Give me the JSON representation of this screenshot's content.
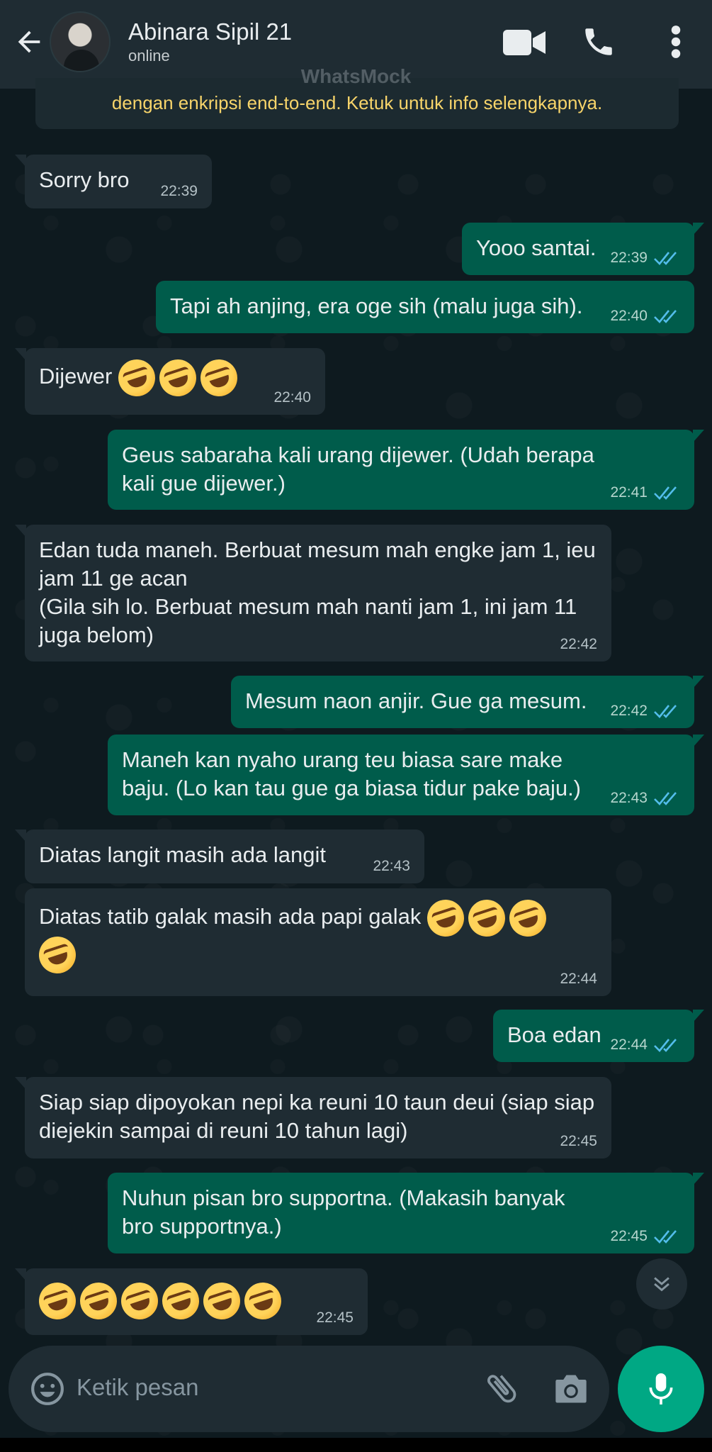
{
  "app": {
    "watermark": "WhatsMock"
  },
  "header": {
    "contact_name": "Abinara Sipil 21",
    "status": "online",
    "icons": [
      "back-arrow-icon",
      "video-call-icon",
      "phone-icon",
      "more-vert-icon"
    ]
  },
  "notice": {
    "text": "dengan enkripsi end-to-end. Ketuk untuk info selengkapnya."
  },
  "messages": [
    {
      "dir": "in",
      "text": "Sorry bro",
      "time": "22:39"
    },
    {
      "dir": "out",
      "text": "Yooo santai.",
      "time": "22:39",
      "read": true
    },
    {
      "dir": "out",
      "text": "Tapi ah anjing, era oge sih (malu juga sih).",
      "time": "22:40",
      "read": true
    },
    {
      "dir": "in",
      "text": "Dijewer",
      "emoji_count": 3,
      "time": "22:40"
    },
    {
      "dir": "out",
      "text": "Geus sabaraha kali urang dijewer. (Udah berapa kali gue dijewer.)",
      "time": "22:41",
      "read": true
    },
    {
      "dir": "in",
      "text": "Edan tuda maneh. Berbuat mesum mah engke jam 1, ieu jam 11 ge acan\n(Gila sih lo. Berbuat mesum mah nanti jam 1, ini jam 11 juga belom)",
      "time": "22:42"
    },
    {
      "dir": "out",
      "text": "Mesum naon anjir. Gue ga mesum.",
      "time": "22:42",
      "read": true
    },
    {
      "dir": "out",
      "text": "Maneh kan nyaho urang teu biasa sare make baju. (Lo kan tau gue ga biasa tidur pake baju.)",
      "time": "22:43",
      "read": true
    },
    {
      "dir": "in",
      "text": "Diatas langit masih ada langit",
      "time": "22:43"
    },
    {
      "dir": "in",
      "text": "Diatas tatib galak masih ada papi galak",
      "emoji_count": 4,
      "time": "22:44"
    },
    {
      "dir": "out",
      "text": "Boa edan",
      "time": "22:44",
      "read": true
    },
    {
      "dir": "in",
      "text": "Siap siap dipoyokan nepi ka reuni 10 taun deui (siap siap diejekin sampai di reuni 10 tahun lagi)",
      "time": "22:45"
    },
    {
      "dir": "out",
      "text": "Nuhun pisan bro supportna. (Makasih banyak bro supportnya.)",
      "time": "22:45",
      "read": true
    },
    {
      "dir": "in",
      "text": "",
      "emoji_count": 6,
      "time": "22:45"
    }
  ],
  "input": {
    "placeholder": "Ketik pesan"
  },
  "colors": {
    "header_bg": "#1f2c33",
    "incoming_bubble": "#1f2c33",
    "outgoing_bubble": "#005c4b",
    "read_tick": "#53bdeb",
    "notice_text": "#f7d46a",
    "mic_button": "#00a884"
  }
}
